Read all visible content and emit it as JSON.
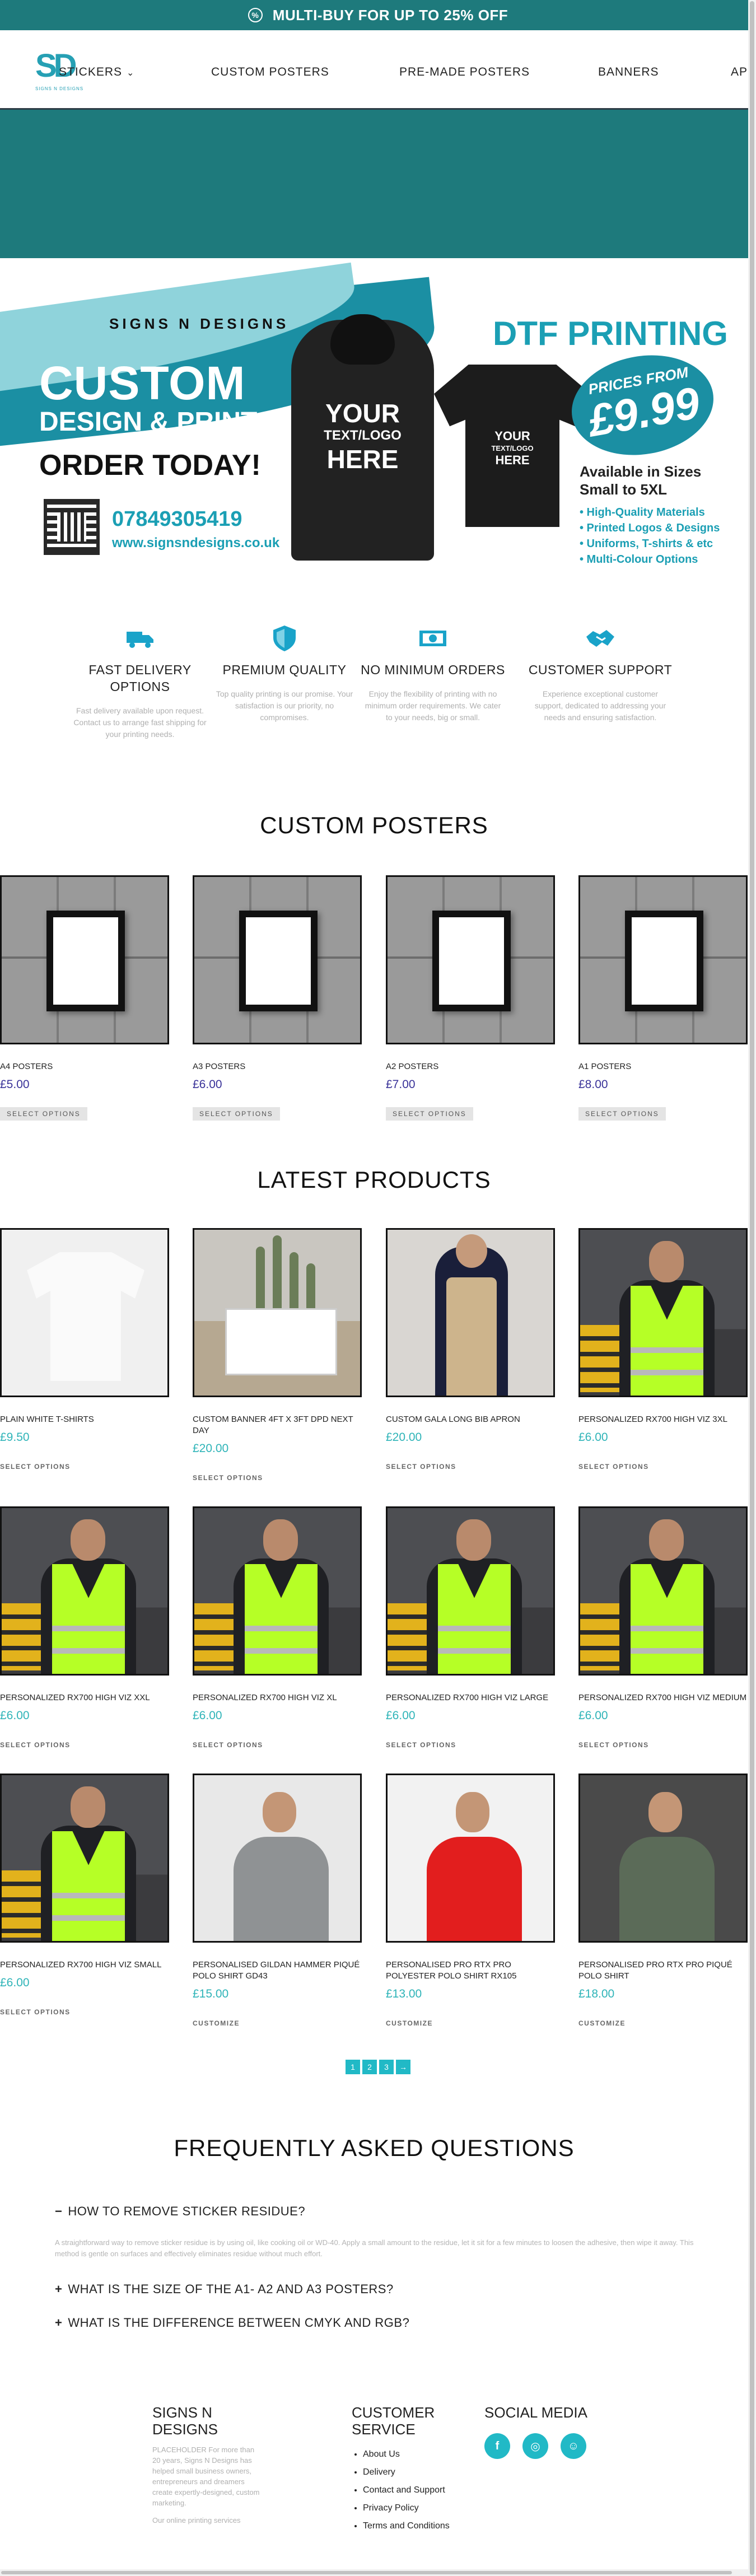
{
  "announcement": {
    "text": "MULTI-BUY FOR UP TO 25% OFF",
    "icon": "percent-badge-icon"
  },
  "header": {
    "logo": {
      "letters": "SD",
      "tagline": "SIGNS N DESIGNS"
    },
    "nav": [
      {
        "label": "STICKERS",
        "dropdown": true
      },
      {
        "label": "CUSTOM POSTERS",
        "dropdown": false
      },
      {
        "label": "PRE-MADE POSTERS",
        "dropdown": false
      },
      {
        "label": "BANNERS",
        "dropdown": false
      },
      {
        "label": "AP",
        "dropdown": false
      }
    ]
  },
  "promo_banner": {
    "brand": "SIGNS N DESIGNS",
    "headline": "CUSTOM",
    "subheadline": "DESIGN & PRINTS",
    "cta": "ORDER TODAY!",
    "phone": "07849305419",
    "website": "www.signsndesigns.co.uk",
    "hoodie_text": [
      "YOUR",
      "TEXT/LOGO",
      "HERE"
    ],
    "polo_text": [
      "YOUR",
      "TEXT/LOGO",
      "HERE"
    ],
    "service": "DTF PRINTING",
    "price_from_label": "PRICES FROM",
    "price_from_value": "£9.99",
    "sizes": "Available in Sizes Small to 5XL",
    "bullets": [
      "• High-Quality Materials",
      "• Printed Logos & Designs",
      "• Uniforms, T-shirts & etc",
      "• Multi-Colour Options"
    ]
  },
  "features": [
    {
      "icon": "truck-icon",
      "title": "FAST DELIVERY OPTIONS",
      "desc": "Fast delivery available upon request. Contact us to arrange fast shipping for your printing needs."
    },
    {
      "icon": "shield-icon",
      "title": "PREMIUM QUALITY",
      "desc": "Top quality printing is our promise. Your satisfaction is our priority, no compromises."
    },
    {
      "icon": "money-icon",
      "title": "NO MINIMUM ORDERS",
      "desc": "Enjoy the flexibility of printing with no minimum order requirements. We cater to your needs, big or small."
    },
    {
      "icon": "handshake-icon",
      "title": "CUSTOMER SUPPORT",
      "desc": "Experience exceptional customer support, dedicated to addressing your needs and ensuring satisfaction."
    }
  ],
  "custom_posters": {
    "title": "CUSTOM POSTERS",
    "items": [
      {
        "name": "A4 POSTERS",
        "price": "£5.00",
        "button": "SELECT OPTIONS"
      },
      {
        "name": "A3 POSTERS",
        "price": "£6.00",
        "button": "SELECT OPTIONS"
      },
      {
        "name": "A2 POSTERS",
        "price": "£7.00",
        "button": "SELECT OPTIONS"
      },
      {
        "name": "A1 POSTERS",
        "price": "£8.00",
        "button": "SELECT OPTIONS"
      }
    ]
  },
  "latest_products": {
    "title": "LATEST PRODUCTS",
    "items": [
      {
        "name": "PLAIN WHITE T-SHIRTS",
        "price": "£9.50",
        "button": "SELECT OPTIONS",
        "image": "tshirt"
      },
      {
        "name": "CUSTOM BANNER 4FT X 3FT DPD NEXT DAY",
        "price": "£20.00",
        "button": "SELECT OPTIONS",
        "image": "banner"
      },
      {
        "name": "CUSTOM GALA LONG BIB APRON",
        "price": "£20.00",
        "button": "SELECT OPTIONS",
        "image": "apron"
      },
      {
        "name": "PERSONALIZED RX700 HIGH VIZ 3XL",
        "price": "£6.00",
        "button": "SELECT OPTIONS",
        "image": "viz"
      },
      {
        "name": "PERSONALIZED RX700 HIGH VIZ XXL",
        "price": "£6.00",
        "button": "SELECT OPTIONS",
        "image": "viz"
      },
      {
        "name": "PERSONALIZED RX700 HIGH VIZ XL",
        "price": "£6.00",
        "button": "SELECT OPTIONS",
        "image": "viz"
      },
      {
        "name": "PERSONALIZED RX700 HIGH VIZ LARGE",
        "price": "£6.00",
        "button": "SELECT OPTIONS",
        "image": "viz"
      },
      {
        "name": "PERSONALIZED RX700 HIGH VIZ MEDIUM",
        "price": "£6.00",
        "button": "SELECT OPTIONS",
        "image": "viz"
      },
      {
        "name": "PERSONALIZED RX700 HIGH VIZ SMALL",
        "price": "£6.00",
        "button": "SELECT OPTIONS",
        "image": "viz"
      },
      {
        "name": "PERSONALISED GILDAN HAMMER PIQUÉ POLO SHIRT GD43",
        "price": "£15.00",
        "button": "CUSTOMIZE",
        "image": "polo-grey"
      },
      {
        "name": "PERSONALISED PRO RTX PRO POLYESTER POLO SHIRT RX105",
        "price": "£13.00",
        "button": "CUSTOMIZE",
        "image": "polo-red"
      },
      {
        "name": "PERSONALISED PRO RTX PRO PIQUÉ POLO SHIRT",
        "price": "£18.00",
        "button": "CUSTOMIZE",
        "image": "polo-green"
      }
    ]
  },
  "pagination": {
    "pages": [
      "1",
      "2",
      "3"
    ],
    "next": "→"
  },
  "faq": {
    "title": "FREQUENTLY ASKED QUESTIONS",
    "items": [
      {
        "symbol": "−",
        "question": "HOW TO REMOVE STICKER RESIDUE?",
        "answer": "A straightforward way to remove sticker residue is by using oil, like cooking oil or WD-40. Apply a small amount to the residue, let it sit for a few minutes to loosen the adhesive, then wipe it away. This method is gentle on surfaces and effectively eliminates residue without much effort."
      },
      {
        "symbol": "+",
        "question": "WHAT IS THE SIZE OF THE A1- A2 AND A3 POSTERS?"
      },
      {
        "symbol": "+",
        "question": "WHAT IS THE DIFFERENCE BETWEEN CMYK AND RGB?"
      }
    ]
  },
  "footer": {
    "about_title": "SIGNS N DESIGNS",
    "about_text": "PLACEHOLDER For more than 20 years, Signs N Designs has helped small business owners, entrepreneurs and dreamers create expertly-designed, custom marketing.",
    "about_text2": "Our online printing services",
    "service_title": "CUSTOMER SERVICE",
    "service_links": [
      "About Us",
      "Delivery",
      "Contact and Support",
      "Privacy Policy",
      "Terms and Conditions"
    ],
    "social_title": "SOCIAL MEDIA",
    "social": [
      {
        "icon": "facebook-icon",
        "glyph": "f"
      },
      {
        "icon": "instagram-icon",
        "glyph": "◎"
      },
      {
        "icon": "snapchat-icon",
        "glyph": "☺"
      }
    ]
  },
  "colors": {
    "teal_dark": "#1e7a7c",
    "teal_accent": "#21b9c6",
    "price_teal": "#2fb4b8",
    "price_purple": "#3a3399"
  }
}
